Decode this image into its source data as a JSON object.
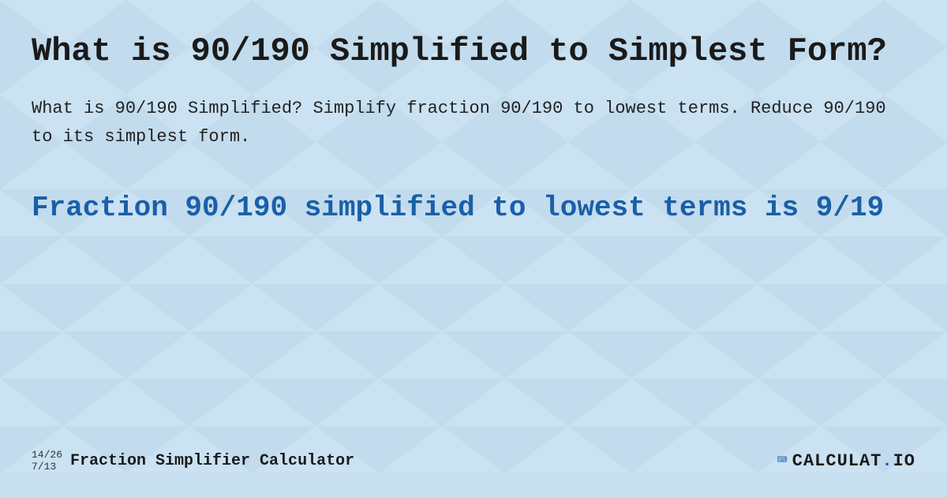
{
  "page": {
    "title": "What is 90/190 Simplified to Simplest Form?",
    "description": "What is 90/190 Simplified? Simplify fraction 90/190 to lowest terms. Reduce 90/190 to its simplest form.",
    "result": "Fraction 90/190 simplified to lowest terms is 9/19",
    "footer": {
      "fractions_line1": "14/26",
      "fractions_line2": "7/13",
      "site_title": "Fraction Simplifier Calculator",
      "logo_text": "CALCULAT.IO"
    }
  }
}
